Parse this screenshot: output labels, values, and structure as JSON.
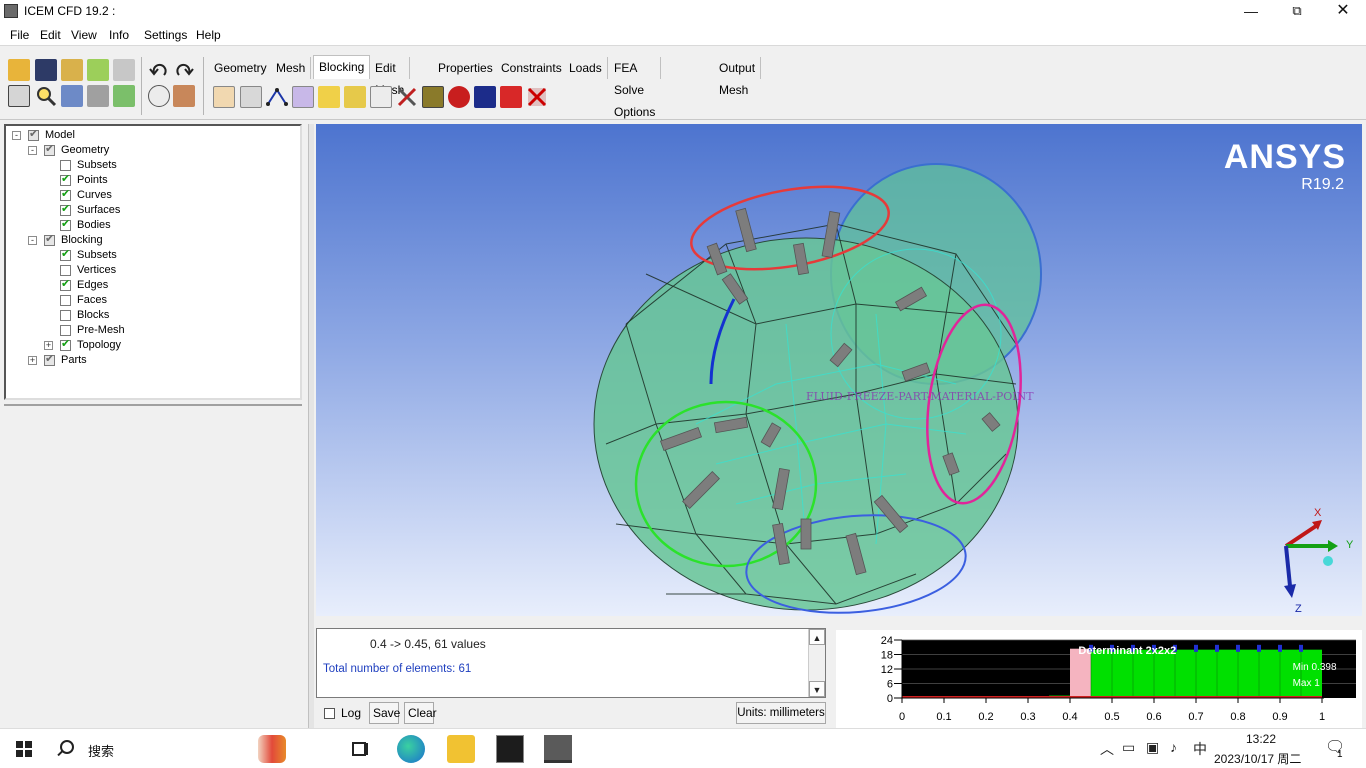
{
  "window": {
    "title": "ICEM CFD 19.2 :",
    "controls": {
      "minimize": "—",
      "maximize": "⧉",
      "close": "✕"
    }
  },
  "menu": [
    "File",
    "Edit",
    "View",
    "Info",
    "Settings",
    "Help"
  ],
  "tabs": [
    {
      "label": "Geometry",
      "active": false
    },
    {
      "label": "Mesh",
      "active": false
    },
    {
      "label": "Blocking",
      "active": true
    },
    {
      "label": "Edit Mesh",
      "active": false
    },
    {
      "label": "Properties",
      "active": false
    },
    {
      "label": "Constraints",
      "active": false
    },
    {
      "label": "Loads",
      "active": false
    },
    {
      "label": "FEA Solve Options",
      "active": false
    },
    {
      "label": "Output Mesh",
      "active": false
    }
  ],
  "tree": [
    {
      "label": "Model",
      "level": 0,
      "expander": "-",
      "check": "partial"
    },
    {
      "label": "Geometry",
      "level": 1,
      "expander": "-",
      "check": "partial"
    },
    {
      "label": "Subsets",
      "level": 2,
      "expander": "",
      "check": "off"
    },
    {
      "label": "Points",
      "level": 2,
      "expander": "",
      "check": "on"
    },
    {
      "label": "Curves",
      "level": 2,
      "expander": "",
      "check": "on"
    },
    {
      "label": "Surfaces",
      "level": 2,
      "expander": "",
      "check": "on"
    },
    {
      "label": "Bodies",
      "level": 2,
      "expander": "",
      "check": "on"
    },
    {
      "label": "Blocking",
      "level": 1,
      "expander": "-",
      "check": "partial"
    },
    {
      "label": "Subsets",
      "level": 2,
      "expander": "",
      "check": "on"
    },
    {
      "label": "Vertices",
      "level": 2,
      "expander": "",
      "check": "off"
    },
    {
      "label": "Edges",
      "level": 2,
      "expander": "",
      "check": "on"
    },
    {
      "label": "Faces",
      "level": 2,
      "expander": "",
      "check": "off"
    },
    {
      "label": "Blocks",
      "level": 2,
      "expander": "",
      "check": "off"
    },
    {
      "label": "Pre-Mesh",
      "level": 2,
      "expander": "",
      "check": "off"
    },
    {
      "label": "Topology",
      "level": 2,
      "expander": "+",
      "check": "on"
    },
    {
      "label": "Parts",
      "level": 1,
      "expander": "+",
      "check": "partial"
    }
  ],
  "viewport": {
    "brand": "ANSYS",
    "release": "R19.2",
    "overlay_label": "FLUID-FREEZE-PART-MATERIAL-POINT",
    "axes": {
      "x": "X",
      "y": "Y",
      "z": "Z"
    }
  },
  "messages": {
    "line1": "0.4 -> 0.45, 61 values",
    "line2": "Total number of elements: 61"
  },
  "controls": {
    "log_label": "Log",
    "save_label": "Save",
    "clear_label": "Clear",
    "units_label": "Units: millimeters"
  },
  "histogram": {
    "title": "Determinant 2x2x2",
    "min_label": "Min 0.398",
    "max_label": "Max 1",
    "y_ticks": [
      "24",
      "18",
      "12",
      "6",
      "0"
    ],
    "x_ticks": [
      "0",
      "0.1",
      "0.2",
      "0.3",
      "0.4",
      "0.5",
      "0.6",
      "0.7",
      "0.8",
      "0.9",
      "1"
    ]
  },
  "chart_data": {
    "type": "bar",
    "title": "Determinant 2x2x2",
    "xlim": [
      0,
      1
    ],
    "ylim": [
      0,
      24
    ],
    "bins": [
      {
        "from": 0.35,
        "to": 0.4,
        "count": 1
      },
      {
        "from": 0.4,
        "to": 0.45,
        "count": 20
      },
      {
        "from": 0.45,
        "to": 0.95,
        "count": 20
      },
      {
        "from": 0.95,
        "to": 1.0,
        "count": 20
      }
    ],
    "highlight_bin": {
      "from": 0.4,
      "to": 0.45,
      "color": "#f5b4c0"
    },
    "bar_color": "#00e000",
    "background": "#000000"
  },
  "taskbar": {
    "search_label": "搜索",
    "ime": "中",
    "time": "13:22",
    "date": "2023/10/17 周二",
    "notifications": "1"
  }
}
